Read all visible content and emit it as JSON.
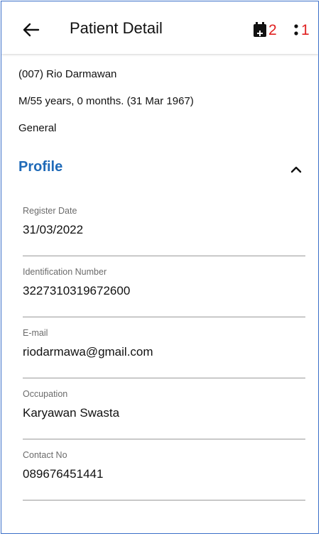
{
  "header": {
    "title": "Patient Detail",
    "calendar_badge": "2",
    "menu_badge": "1"
  },
  "patient": {
    "id_name": "(007) Rio Darmawan",
    "demographics": "M/55 years, 0 months. (31 Mar 1967)",
    "type": "General"
  },
  "profile": {
    "section_title": "Profile",
    "fields": [
      {
        "label": "Register Date",
        "value": "31/03/2022"
      },
      {
        "label": "Identification Number",
        "value": "3227310319672600"
      },
      {
        "label": "E-mail",
        "value": "riodarmawa@gmail.com"
      },
      {
        "label": "Occupation",
        "value": "Karyawan Swasta"
      },
      {
        "label": "Contact No",
        "value": "089676451441"
      }
    ]
  },
  "colors": {
    "accent": "#1f6ab8",
    "badge": "#e02020",
    "frame": "#3b6fc8"
  },
  "icons": {
    "back": "arrow-left-icon",
    "calendar": "calendar-plus-icon",
    "menu": "more-vertical-icon",
    "collapse": "chevron-up-icon"
  }
}
